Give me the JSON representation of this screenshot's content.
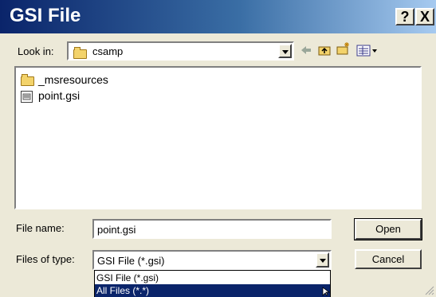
{
  "window": {
    "title": "GSI File",
    "help_glyph": "?",
    "close_glyph": "X"
  },
  "lookin": {
    "label": "Look in:",
    "folder": "csamp"
  },
  "toolbar": {
    "back_icon": "back-arrow-icon",
    "up_icon": "up-folder-icon",
    "new_icon": "new-folder-icon",
    "view_icon": "view-menu-icon"
  },
  "files": [
    {
      "name": "_msresources",
      "icon": "folder-icon"
    },
    {
      "name": "point.gsi",
      "icon": "gsi-file-icon"
    }
  ],
  "filename": {
    "label": "File name:",
    "value": "point.gsi"
  },
  "filetype": {
    "label": "Files of type:",
    "selected": "GSI File (*.gsi)",
    "options": [
      "GSI File (*.gsi)",
      "All Files (*.*)"
    ]
  },
  "buttons": {
    "open": "Open",
    "cancel": "Cancel"
  },
  "colors": {
    "title_bar": "#0a246a",
    "selection": "#0a246a",
    "dialog_bg": "#ece9d8"
  }
}
